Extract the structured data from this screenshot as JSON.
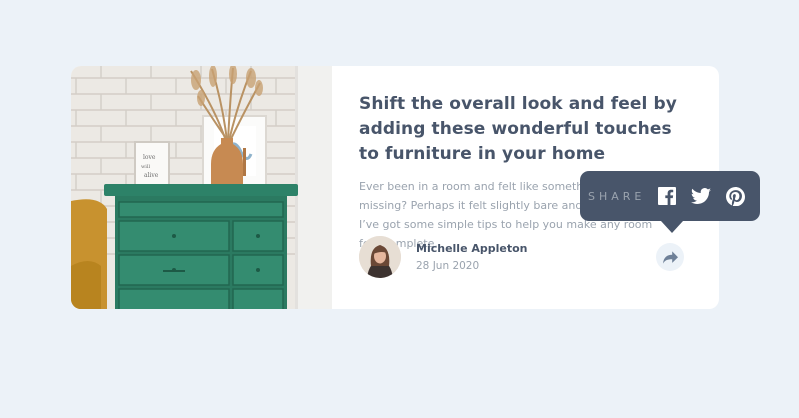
{
  "article": {
    "title": "Shift the overall look and feel by adding these wonderful touches to furniture in your home",
    "excerpt": "Ever been in a room and felt like something was missing? Perhaps it felt slightly bare and uninviting. I’ve got some simple tips to help you make any room feel complete."
  },
  "author": {
    "name": "Michelle Appleton",
    "date": "28 Jun 2020"
  },
  "share": {
    "label": "SHARE",
    "icons": [
      "facebook-icon",
      "twitter-icon",
      "pinterest-icon"
    ]
  },
  "colors": {
    "page_background": "#ecf2f8",
    "card_background": "#ffffff",
    "heading": "#48556a",
    "muted_text": "#9aa3ae",
    "share_popup": "#48556a",
    "dresser_green": "#2f7a62"
  }
}
